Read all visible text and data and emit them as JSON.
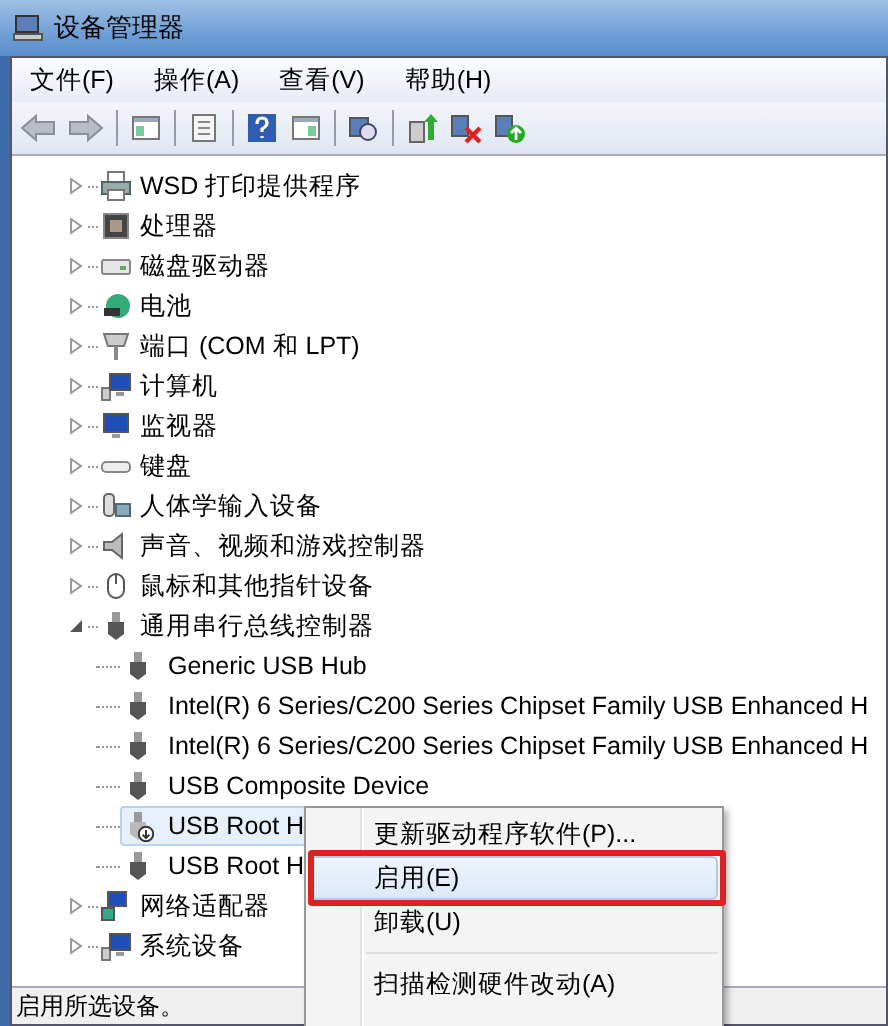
{
  "window": {
    "title": "设备管理器"
  },
  "menu_bar": [
    "文件(F)",
    "操作(A)",
    "查看(V)",
    "帮助(H)"
  ],
  "tree": [
    {
      "label": "WSD 打印提供程序",
      "kind": "printer",
      "expanded": false
    },
    {
      "label": "处理器",
      "kind": "cpu",
      "expanded": false
    },
    {
      "label": "磁盘驱动器",
      "kind": "disk",
      "expanded": false
    },
    {
      "label": "电池",
      "kind": "battery",
      "expanded": false
    },
    {
      "label": "端口 (COM 和 LPT)",
      "kind": "port",
      "expanded": false
    },
    {
      "label": "计算机",
      "kind": "computer",
      "expanded": false
    },
    {
      "label": "监视器",
      "kind": "monitor",
      "expanded": false
    },
    {
      "label": "键盘",
      "kind": "keyboard",
      "expanded": false
    },
    {
      "label": "人体学输入设备",
      "kind": "hid",
      "expanded": false
    },
    {
      "label": "声音、视频和游戏控制器",
      "kind": "sound",
      "expanded": false
    },
    {
      "label": "鼠标和其他指针设备",
      "kind": "mouse",
      "expanded": false
    },
    {
      "label": "通用串行总线控制器",
      "kind": "usb",
      "expanded": true,
      "children": [
        {
          "label": "Generic USB Hub",
          "disabled": false,
          "selected": false
        },
        {
          "label": "Intel(R) 6 Series/C200 Series Chipset Family USB Enhanced H",
          "disabled": false,
          "selected": false
        },
        {
          "label": "Intel(R) 6 Series/C200 Series Chipset Family USB Enhanced H",
          "disabled": false,
          "selected": false
        },
        {
          "label": "USB Composite Device",
          "disabled": false,
          "selected": false
        },
        {
          "label": "USB Root H",
          "disabled": true,
          "selected": true
        },
        {
          "label": "USB Root H",
          "disabled": false,
          "selected": false
        }
      ]
    },
    {
      "label": "网络适配器",
      "kind": "network",
      "expanded": false
    },
    {
      "label": "系统设备",
      "kind": "computer",
      "expanded": false
    }
  ],
  "context_menu": [
    {
      "label": "更新驱动程序软件(P)...",
      "selected": false,
      "marked": false
    },
    {
      "label": "启用(E)",
      "selected": true,
      "marked": true
    },
    {
      "label": "卸载(U)",
      "selected": false,
      "marked": false
    },
    {
      "label": "扫描检测硬件改动(A)",
      "selected": false,
      "marked": false,
      "separator_before": true
    }
  ],
  "status_bar": "启用所选设备。"
}
